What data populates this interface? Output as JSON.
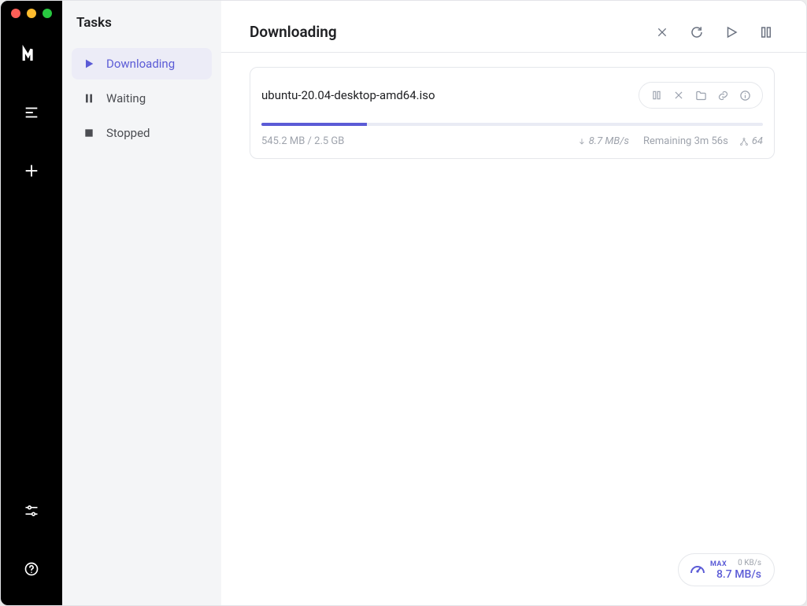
{
  "sidebar": {
    "title": "Tasks",
    "items": [
      {
        "label": "Downloading"
      },
      {
        "label": "Waiting"
      },
      {
        "label": "Stopped"
      }
    ]
  },
  "page": {
    "title": "Downloading"
  },
  "task": {
    "filename": "ubuntu-20.04-desktop-amd64.iso",
    "downloaded": "545.2 MB",
    "total": "2.5 GB",
    "size_line": "545.2 MB / 2.5 GB",
    "progress_percent": 21,
    "speed": "8.7 MB/s",
    "remaining": "Remaining 3m 56s",
    "connections": "64"
  },
  "footer": {
    "max_label": "MAX",
    "up_speed": "0 KB/s",
    "down_speed": "8.7 MB/s"
  },
  "accent_color": "#5b5bd6"
}
